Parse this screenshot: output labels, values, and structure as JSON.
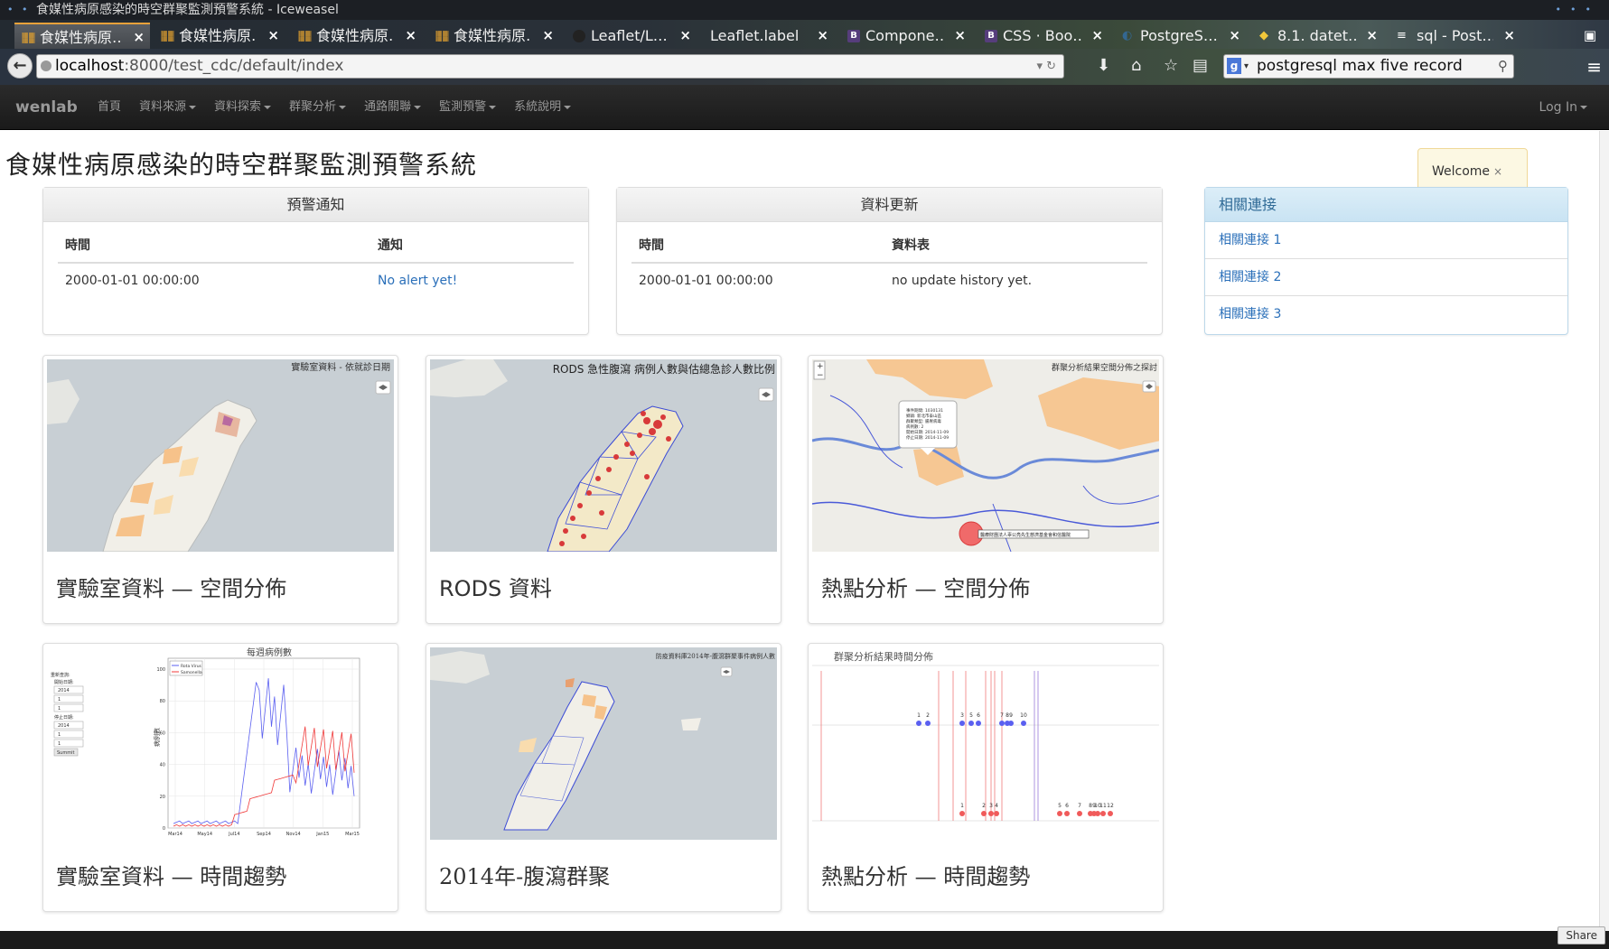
{
  "window": {
    "title": "食媒性病原感染的時空群聚監測預警系統 - Iceweasel"
  },
  "tabs": [
    {
      "label": "食媒性病原…",
      "close": "×",
      "favicon": "app"
    },
    {
      "label": "食媒性病原…",
      "close": "×",
      "favicon": "app"
    },
    {
      "label": "食媒性病原…",
      "close": "×",
      "favicon": "app"
    },
    {
      "label": "食媒性病原…",
      "close": "×",
      "favicon": "app"
    },
    {
      "label": "Leaflet/L…",
      "close": "×",
      "favicon": "github"
    },
    {
      "label": "Leaflet.label",
      "close": "×",
      "favicon": "none"
    },
    {
      "label": "Compone…",
      "close": "×",
      "favicon": "B"
    },
    {
      "label": "CSS · Boo…",
      "close": "×",
      "favicon": "B"
    },
    {
      "label": "PostgreS…",
      "close": "×",
      "favicon": "elephant"
    },
    {
      "label": "8.1. datet…",
      "close": "×",
      "favicon": "python"
    },
    {
      "label": "sql - Post…",
      "close": "×",
      "favicon": "none"
    }
  ],
  "addressbar": {
    "host": "localhost",
    "path": ":8000/test_cdc/default/index"
  },
  "search": {
    "engine_letter": "g",
    "value": "postgresql max five record"
  },
  "appnav": {
    "brand": "wenlab",
    "items": [
      {
        "label": "首頁",
        "dropdown": false
      },
      {
        "label": "資料來源",
        "dropdown": true
      },
      {
        "label": "資料探索",
        "dropdown": true
      },
      {
        "label": "群聚分析",
        "dropdown": true
      },
      {
        "label": "通路關聯",
        "dropdown": true
      },
      {
        "label": "監測預警",
        "dropdown": true
      },
      {
        "label": "系統說明",
        "dropdown": true
      }
    ],
    "login": "Log In"
  },
  "page": {
    "title": "食媒性病原感染的時空群聚監測預警系統",
    "welcome": "Welcome",
    "welcome_close": "×"
  },
  "alerts": {
    "heading": "預警通知",
    "col_time": "時間",
    "col_notice": "通知",
    "rows": [
      {
        "time": "2000-01-01 00:00:00",
        "notice": "No alert yet!"
      }
    ]
  },
  "updates": {
    "heading": "資料更新",
    "col_time": "時間",
    "col_table": "資料表",
    "rows": [
      {
        "time": "2000-01-01 00:00:00",
        "table": "no update history yet."
      }
    ]
  },
  "links": {
    "heading": "相關連接",
    "items": [
      "相關連接 1",
      "相關連接 2",
      "相關連接 3"
    ]
  },
  "thumbnails": [
    {
      "caption": "實驗室資料 — 空間分佈",
      "map_title": "實驗室資料 - 依就診日期"
    },
    {
      "caption": "RODS 資料",
      "map_title": "RODS 急性腹瀉 病例人數與估總急診人數比例"
    },
    {
      "caption": "熱點分析 — 空間分佈",
      "map_title": "群聚分析結果空間分佈之探討"
    },
    {
      "caption": "實驗室資料 — 時間趨勢",
      "map_title": "每週病例數"
    },
    {
      "caption": "2014年-腹瀉群聚",
      "map_title": "防疫資料庫2014年-腹瀉群聚事件病例人數"
    },
    {
      "caption": "熱點分析 — 時間趨勢",
      "map_title": "群聚分析結果時間分佈"
    }
  ],
  "trend_chart": {
    "form_title": "重新查詢:",
    "start_label": "開始日期:",
    "end_label": "停止日期:",
    "start_year": "2014",
    "start_month": "1",
    "start_day": "1",
    "end_year": "2014",
    "end_month": "1",
    "end_day": "1",
    "submit": "Summit",
    "legend": [
      "Rota Virus",
      "Samonella"
    ],
    "ylabel": "病例數",
    "yticks": [
      "0",
      "20",
      "40",
      "60",
      "80",
      "100"
    ],
    "xticks": [
      "Mar14",
      "May14",
      "Jul14",
      "Sep14",
      "Nov14",
      "Jan15",
      "Mar15"
    ]
  },
  "timeline_chart": {
    "top_labels": [
      "1",
      "2",
      "3",
      "5",
      "6",
      "7",
      "8",
      "9",
      "10"
    ],
    "bottom_labels": [
      "1",
      "2",
      "3",
      "4",
      "5",
      "6",
      "7",
      "8",
      "9",
      "10",
      "11",
      "12"
    ]
  },
  "hotspot_popup": {
    "lines": [
      "事件期間: 1030131",
      "鄉鎮: 新北市泰山區",
      "群聚類型: 腸胃病毒",
      "病例數: 2",
      "開始日期: 2014-11-09",
      "停止日期: 2014-11-09"
    ],
    "marker_label": "醫療財團法人辜公亮先生慈濟基金會和信醫院"
  },
  "footer": {
    "share": "Share"
  },
  "colors": {
    "link": "#2a6fb9",
    "navbar": "#222222",
    "welcome_bg": "#fcf8e3",
    "info_heading": "#d9edf7",
    "map_sea": "#c8cfd4",
    "map_land": "#f1efe8",
    "map_choropleth": "#f6c28a",
    "marker_red": "#d83a3a",
    "rota_blue": "#5a5ff0",
    "samonella_red": "#f03a3a"
  }
}
